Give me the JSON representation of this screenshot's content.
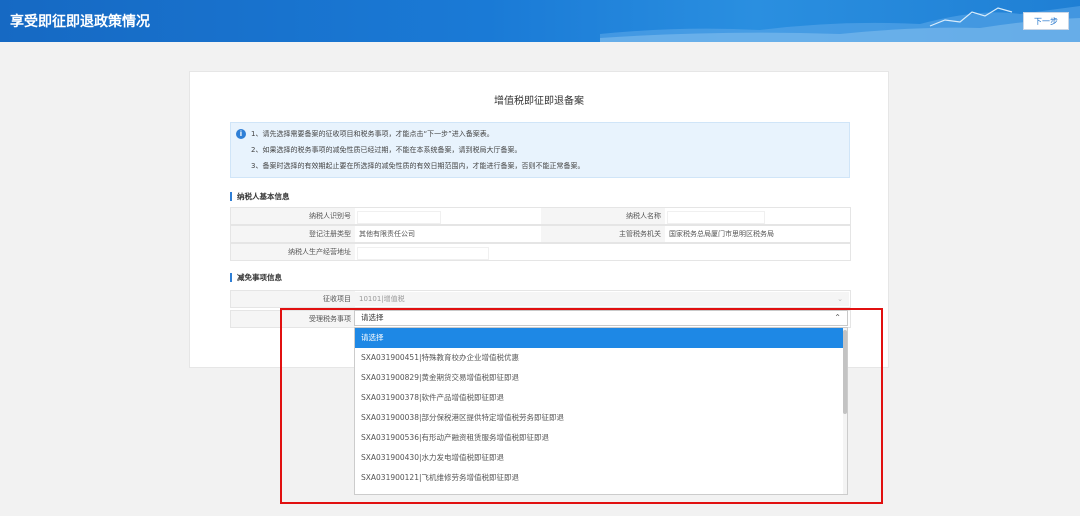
{
  "header": {
    "title": "享受即征即退政策情况",
    "next_label": "下一步"
  },
  "card": {
    "title": "增值税即征即退备案"
  },
  "notice": {
    "lines": [
      "1、请先选择需要备案的征收项目和税务事项，才能点击“下一步”进入备案表。",
      "2、如果选择的税务事项的减免性质已经过期，不能在本系统备案，请到税局大厅备案。",
      "3、备案时选择的有效期起止要在所选择的减免性质的有效日期范围内，才能进行备案，否则不能正常备案。"
    ]
  },
  "taxpayer_section": {
    "title": "纳税人基本信息",
    "tax_id_label": "纳税人识别号",
    "tax_id_value": "",
    "name_label": "纳税人名称",
    "name_value": "",
    "reg_type_label": "登记注册类型",
    "reg_type_value": "其他有限责任公司",
    "authority_label": "主管税务机关",
    "authority_value": "国家税务总局厦门市思明区税务局",
    "address_label": "纳税人生产经营地址",
    "address_value": ""
  },
  "exemption_section": {
    "title": "减免事项信息",
    "levy_item_label": "征收项目",
    "levy_item_value": "10101|增值税",
    "matter_label": "受理税务事项",
    "matter_value": "请选择"
  },
  "dropdown": {
    "options": [
      "请选择",
      "SXA031900451|特殊教育校办企业增值税优惠",
      "SXA031900829|黄金期货交易增值税即征即退",
      "SXA031900378|软件产品增值税即征即退",
      "SXA031900038|部分保税港区提供特定增值税劳务即征即退",
      "SXA031900536|有形动产融资租赁服务增值税即征即退",
      "SXA031900430|水力发电增值税即征即退",
      "SXA031900121|飞机维修劳务增值税即征即退"
    ],
    "selected_index": 0
  },
  "colors": {
    "header_blue": "#1a7ad6",
    "selected_blue": "#1e88e5",
    "highlight_red": "#e11010"
  }
}
